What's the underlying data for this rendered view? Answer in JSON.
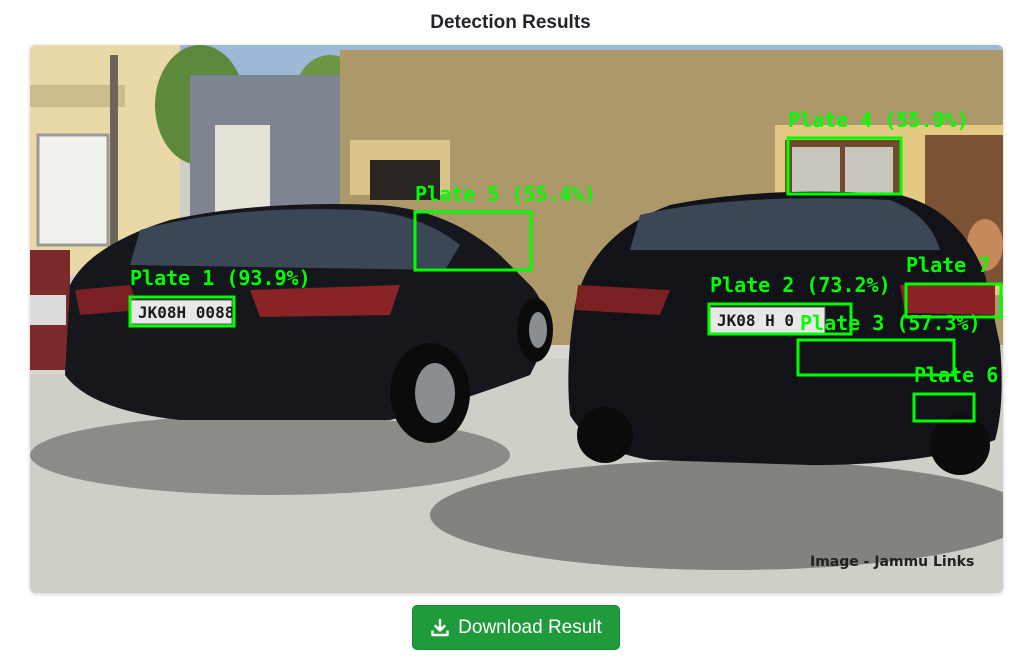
{
  "header": {
    "title": "Detection Results"
  },
  "result_image": {
    "watermark": "Image - Jammu Links",
    "plate_texts": {
      "left_car": "JK08H 0088",
      "right_car": "JK08 H 0"
    },
    "detections": [
      {
        "label": "Plate 1 (93.9%)"
      },
      {
        "label": "Plate 2 (73.2%)"
      },
      {
        "label": "Plate 3 (57.3%)"
      },
      {
        "label": "Plate 4 (55.9%)"
      },
      {
        "label": "Plate 5 (55.4%)"
      },
      {
        "label": "Plate 6"
      },
      {
        "label": "Plate 7"
      }
    ],
    "box_color": "#00ff00"
  },
  "actions": {
    "download_label": "Download Result",
    "download_icon": "download-icon"
  },
  "colors": {
    "accent": "#1f9b3b"
  }
}
